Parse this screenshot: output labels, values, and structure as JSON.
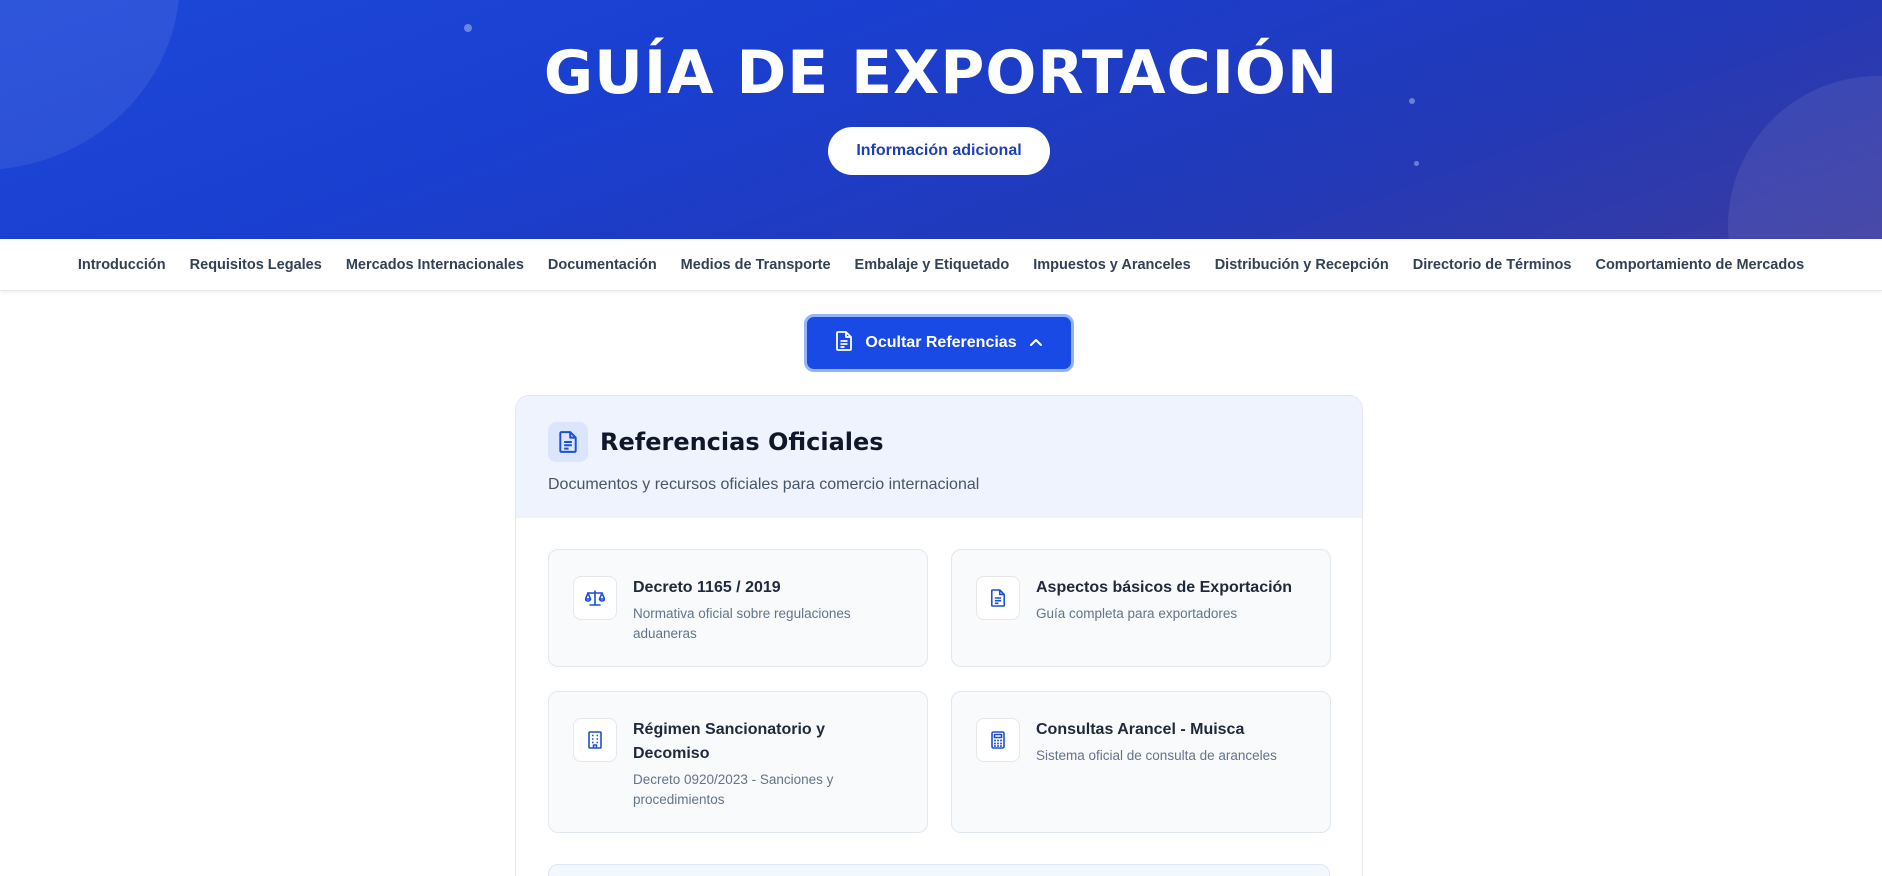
{
  "hero": {
    "title": "GUÍA DE EXPORTACIÓN",
    "info_button": "Información adicional"
  },
  "nav": {
    "items": [
      "Introducción",
      "Requisitos Legales",
      "Mercados Internacionales",
      "Documentación",
      "Medios de Transporte",
      "Embalaje y Etiquetado",
      "Impuestos y Aranceles",
      "Distribución y Recepción",
      "Directorio de Términos",
      "Comportamiento de Mercados"
    ]
  },
  "toggle": {
    "label": "Ocultar Referencias",
    "icon": "document-icon",
    "chevron": "chevron-up-icon"
  },
  "references": {
    "title": "Referencias Oficiales",
    "subtitle": "Documentos y recursos oficiales para comercio internacional",
    "items": [
      {
        "title": "Decreto 1165 / 2019",
        "desc": "Normativa oficial sobre regulaciones aduaneras",
        "icon": "scale-icon"
      },
      {
        "title": "Aspectos básicos de Exportación",
        "desc": "Guía completa para exportadores",
        "icon": "document-icon"
      },
      {
        "title": "Régimen Sancionatorio y Decomiso",
        "desc": "Decreto 0920/2023 - Sanciones y procedimientos",
        "icon": "building-icon"
      },
      {
        "title": "Consultas Arancel - Muisca",
        "desc": "Sistema oficial de consulta de aranceles",
        "icon": "calculator-icon"
      }
    ]
  },
  "colors": {
    "hero_start": "#1d48d8",
    "hero_end": "#3a3aa0",
    "accent": "#1a4ae6",
    "panel_head_bg": "#eef3fe"
  }
}
